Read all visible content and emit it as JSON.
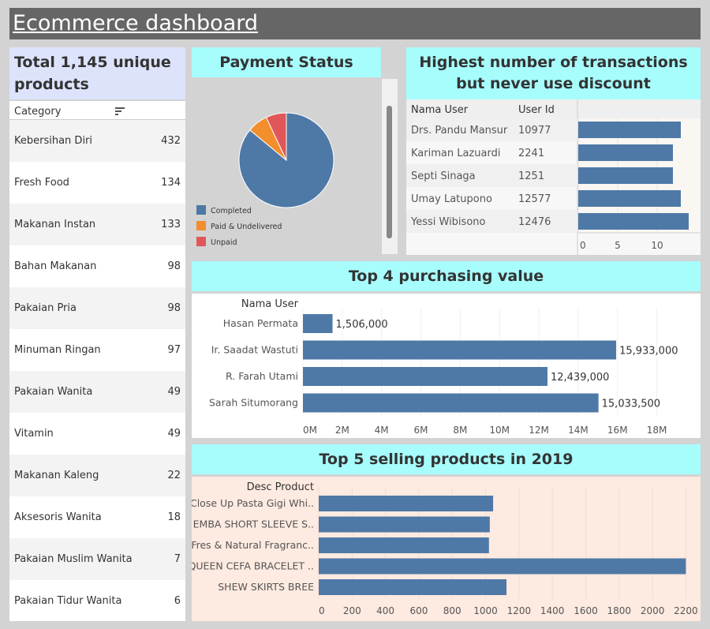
{
  "title": "Ecommerce dashboard",
  "products": {
    "title": "Total 1,145 unique products",
    "column_header": "Category",
    "rows": [
      {
        "name": "Kebersihan Diri",
        "value": "432"
      },
      {
        "name": "Fresh Food",
        "value": "134"
      },
      {
        "name": "Makanan Instan",
        "value": "133"
      },
      {
        "name": "Bahan Makanan",
        "value": "98"
      },
      {
        "name": "Pakaian Pria",
        "value": "98"
      },
      {
        "name": "Minuman Ringan",
        "value": "97"
      },
      {
        "name": "Pakaian Wanita",
        "value": "49"
      },
      {
        "name": "Vitamin",
        "value": "49"
      },
      {
        "name": "Makanan Kaleng",
        "value": "22"
      },
      {
        "name": "Aksesoris Wanita",
        "value": "18"
      },
      {
        "name": "Pakaian Muslim Wanita",
        "value": "7"
      },
      {
        "name": "Pakaian Tidur Wanita",
        "value": "6"
      }
    ]
  },
  "colors": {
    "bar": "#4e79a7",
    "completed": "#4e79a7",
    "paid_undelivered": "#f28e2b",
    "unpaid": "#e15759",
    "head_cyan": "#a7fcfc",
    "head_lavender": "#dde3fb",
    "peach": "#fdeae0"
  },
  "chart_data": [
    {
      "type": "pie",
      "title": "Payment Status",
      "categories": [
        "Completed",
        "Paid & Undelivered",
        "Unpaid"
      ],
      "values": [
        86,
        7,
        7
      ]
    },
    {
      "type": "bar",
      "orientation": "horizontal",
      "title": "Highest number of transactions but never use discount",
      "columns": [
        "Nama User",
        "User Id"
      ],
      "categories": [
        "Drs. Pandu Mansur",
        "Kariman Lazuardi",
        "Septi Sinaga",
        "Umay Latupono",
        "Yessi Wibisono"
      ],
      "user_ids": [
        "10977",
        "2241",
        "1251",
        "12577",
        "12476"
      ],
      "values": [
        13,
        12,
        12,
        13,
        14
      ],
      "xticks": [
        "0",
        "5",
        "10"
      ],
      "xlim": [
        0,
        15
      ],
      "grid": true
    },
    {
      "type": "bar",
      "orientation": "horizontal",
      "title": "Top 4 purchasing value",
      "ylabel": "Nama User",
      "categories": [
        "Hasan Permata",
        "Ir. Saadat Wastuti",
        "R. Farah Utami",
        "Sarah Situmorang"
      ],
      "values": [
        1506000,
        15933000,
        12439000,
        15033500
      ],
      "labels": [
        "1,506,000",
        "15,933,000",
        "12,439,000",
        "15,033,500"
      ],
      "xticks": [
        "0M",
        "2M",
        "4M",
        "6M",
        "8M",
        "10M",
        "12M",
        "14M",
        "16M",
        "18M"
      ],
      "xlim": [
        0,
        19000000
      ],
      "grid": true
    },
    {
      "type": "bar",
      "orientation": "horizontal",
      "title": "Top 5 selling products in 2019",
      "ylabel": "Desc Product",
      "categories": [
        "Close Up Pasta Gigi Whi..",
        "EMBA SHORT SLEEVE S..",
        "Fres & Natural Fragranc..",
        "QUEEN CEFA BRACELET ..",
        "SHEW SKIRTS BREE"
      ],
      "values": [
        1045,
        1025,
        1020,
        2200,
        1125
      ],
      "xticks": [
        "0",
        "200",
        "400",
        "600",
        "800",
        "1000",
        "1200",
        "1400",
        "1600",
        "1800",
        "2000",
        "2200"
      ],
      "xlim": [
        0,
        2250
      ],
      "grid": true
    }
  ]
}
